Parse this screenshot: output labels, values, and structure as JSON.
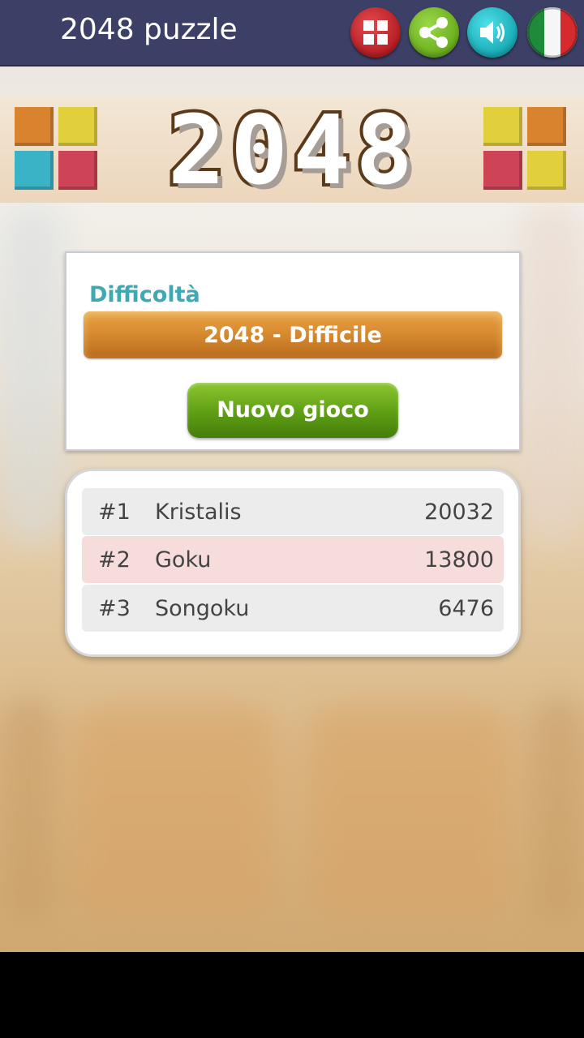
{
  "app": {
    "title": "2048 puzzle"
  },
  "toolbar": {
    "buttons": [
      {
        "name": "more-games-button",
        "icon": "grid-icon",
        "color": "#c62a2f"
      },
      {
        "name": "share-button",
        "icon": "share-icon",
        "color": "#7fbf2a"
      },
      {
        "name": "sound-button",
        "icon": "speaker-icon",
        "color": "#27c4cf"
      },
      {
        "name": "language-button",
        "icon": "italy-flag-icon",
        "color": "#ffffff"
      }
    ]
  },
  "banner": {
    "logo_text": "2048"
  },
  "settings": {
    "difficulty_label": "Difficoltà",
    "difficulty_value": "2048 - Difficile",
    "new_game_label": "Nuovo gioco"
  },
  "leaderboard": {
    "rows": [
      {
        "rank": "#1",
        "name": "Kristalis",
        "score": "20032"
      },
      {
        "rank": "#2",
        "name": "Goku",
        "score": "13800"
      },
      {
        "rank": "#3",
        "name": "Songoku",
        "score": "6476"
      }
    ]
  },
  "colors": {
    "topbar": "#3d4066",
    "accent_teal": "#3fa8b4",
    "select_orange": "#d98b2f",
    "button_green": "#5e9e14",
    "row_highlight": "#f7dcdc",
    "row_default": "#ececec"
  }
}
